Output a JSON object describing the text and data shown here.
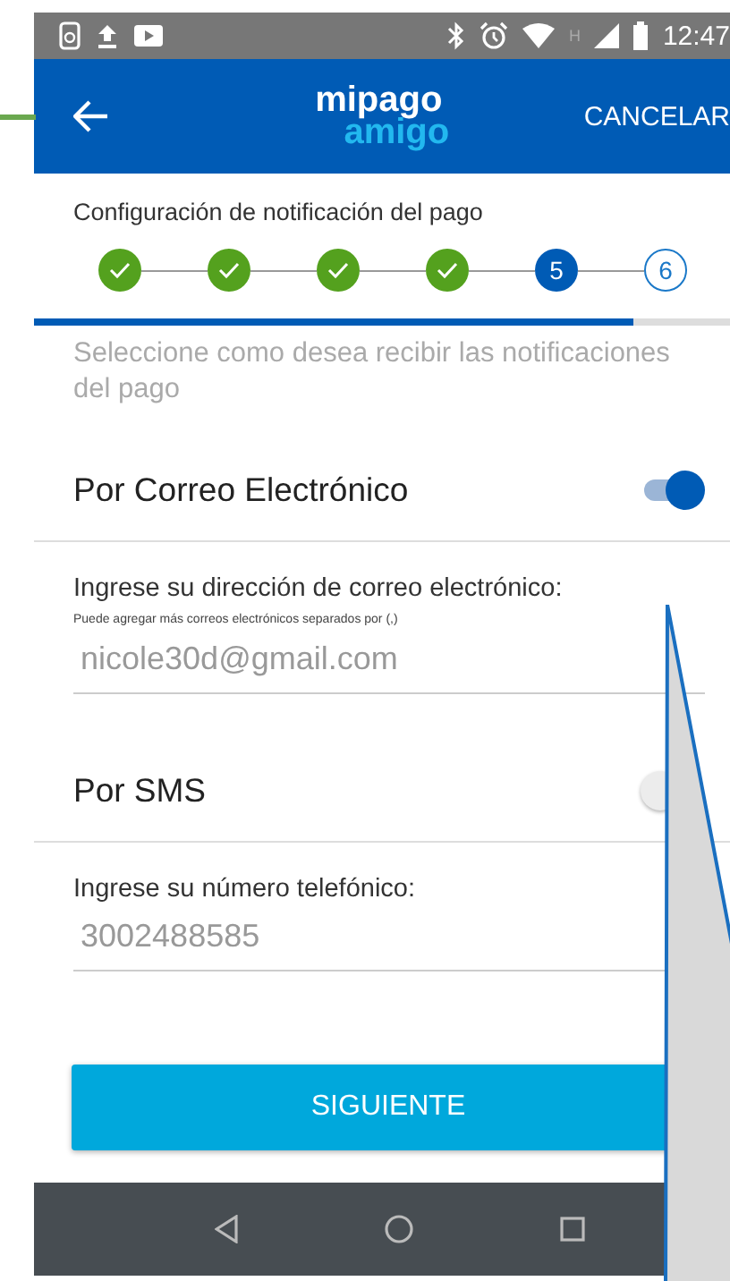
{
  "status_bar": {
    "time": "12:47",
    "network": "H"
  },
  "header": {
    "logo_top": "mipago",
    "logo_bottom": "amigo",
    "action": "CANCELAR"
  },
  "wizard": {
    "title": "Configuración de notificación del pago",
    "steps": [
      {
        "completed": true,
        "selected": false
      },
      {
        "completed": true,
        "selected": false
      },
      {
        "completed": true,
        "selected": false
      },
      {
        "completed": true,
        "selected": false
      },
      {
        "completed": false,
        "selected": true,
        "label": "5"
      },
      {
        "completed": false,
        "selected": false,
        "label": "6"
      }
    ],
    "level": 0.86
  },
  "intro": "Seleccione como desea recibir las notificaciones del pago",
  "channels": [
    {
      "label": "Por Correo Electrónico",
      "on": true,
      "field_label": "Ingrese su dirección de correo electrónico:",
      "hint": "Puede agregar más correos electrónicos separados por (,)",
      "value": "nicole30d@gmail.com"
    },
    {
      "label": "Por SMS",
      "on": false,
      "field_label": "Ingrese su número telefónico:",
      "value": "3002488585"
    }
  ],
  "button": "SIGUIENTE"
}
